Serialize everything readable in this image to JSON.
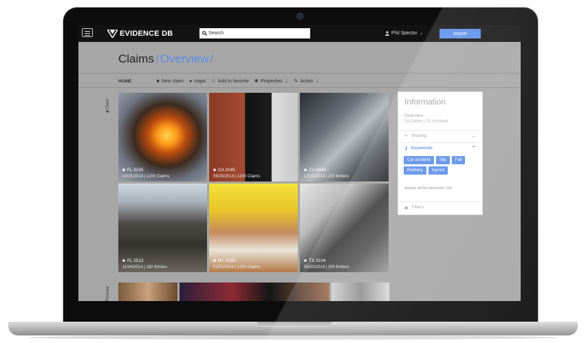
{
  "app": {
    "brand": "EVIDENCE DB",
    "search_placeholder": "Search",
    "user": "Phil Spector",
    "import_label": "Import"
  },
  "breadcrumb": {
    "root": "Claims",
    "sep": "/",
    "current": "Overview",
    "trail": "/"
  },
  "toolbar": {
    "home": "HOME",
    "items": [
      {
        "label": "New claim",
        "icon": "folder-icon"
      },
      {
        "label": "maps",
        "icon": "globe-icon"
      },
      {
        "label": "Add to favorite",
        "icon": "star-icon"
      },
      {
        "label": "Properties",
        "icon": "gear-icon"
      },
      {
        "label": "Action",
        "icon": "wrench-icon"
      }
    ]
  },
  "side_labels": {
    "claim": "Claim",
    "pictures": "Pictures"
  },
  "claims": [
    {
      "code": "FL 3105",
      "meta": "10/25/2014 | 1200 Claims"
    },
    {
      "code": "CA 2145",
      "meta": "09/20/2014 | 1200 Claims"
    },
    {
      "code": "CA 6943",
      "meta": "12/15/2014 | 200 fichiers"
    },
    {
      "code": "FL 2513",
      "meta": "11/04/2014 | 182 fichiers"
    },
    {
      "code": "NY 2035",
      "meta": "01/01/2014 | 1200 Claims"
    },
    {
      "code": "TX 3104",
      "meta": "09/20/2014 | 200 fichiers"
    }
  ],
  "info": {
    "title": "Information",
    "overview": "Overview",
    "overview_stats": "14 Claims | 10 Archived",
    "sharing": "Sharing",
    "keywords_title": "Keywords",
    "keywords": [
      "Car accident",
      "Slip",
      "Fall",
      "Robbery",
      "Injured"
    ],
    "display_all": "display all the keywords (16)",
    "filters": "Filters"
  },
  "colors": {
    "accent": "#5b8fe8",
    "topbar": "#121212"
  }
}
